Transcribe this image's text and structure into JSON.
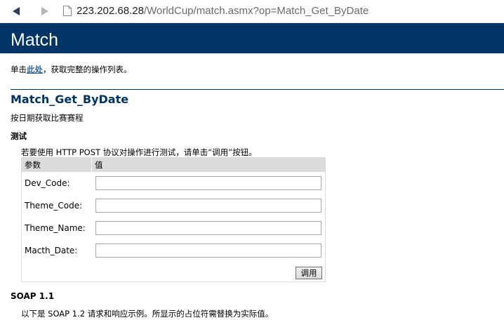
{
  "browser": {
    "url_host": "223.202.68.28",
    "url_path": "/WorldCup/match.asmx?op=Match_Get_ByDate"
  },
  "header": {
    "title": "Match"
  },
  "intro": {
    "prefix": "单击",
    "link_text": "此处",
    "suffix": "，获取完整的操作列表。"
  },
  "operation": {
    "name": "Match_Get_ByDate",
    "description": "按日期获取比赛赛程"
  },
  "test": {
    "heading": "测试",
    "instructions": "若要使用 HTTP POST 协议对操作进行测试，请单击“调用”按钮。",
    "column_param": "参数",
    "column_value": "值",
    "params": [
      {
        "label": "Dev_Code:",
        "value": ""
      },
      {
        "label": "Theme_Code:",
        "value": ""
      },
      {
        "label": "Theme_Name:",
        "value": ""
      },
      {
        "label": "Macth_Date:",
        "value": ""
      }
    ],
    "invoke_label": "调用"
  },
  "soap": {
    "heading": "SOAP 1.1",
    "description": "以下是 SOAP 1.2 请求和响应示例。所显示的占位符需替换为实际值。"
  },
  "colors": {
    "banner": "#003366",
    "link": "#336699"
  }
}
